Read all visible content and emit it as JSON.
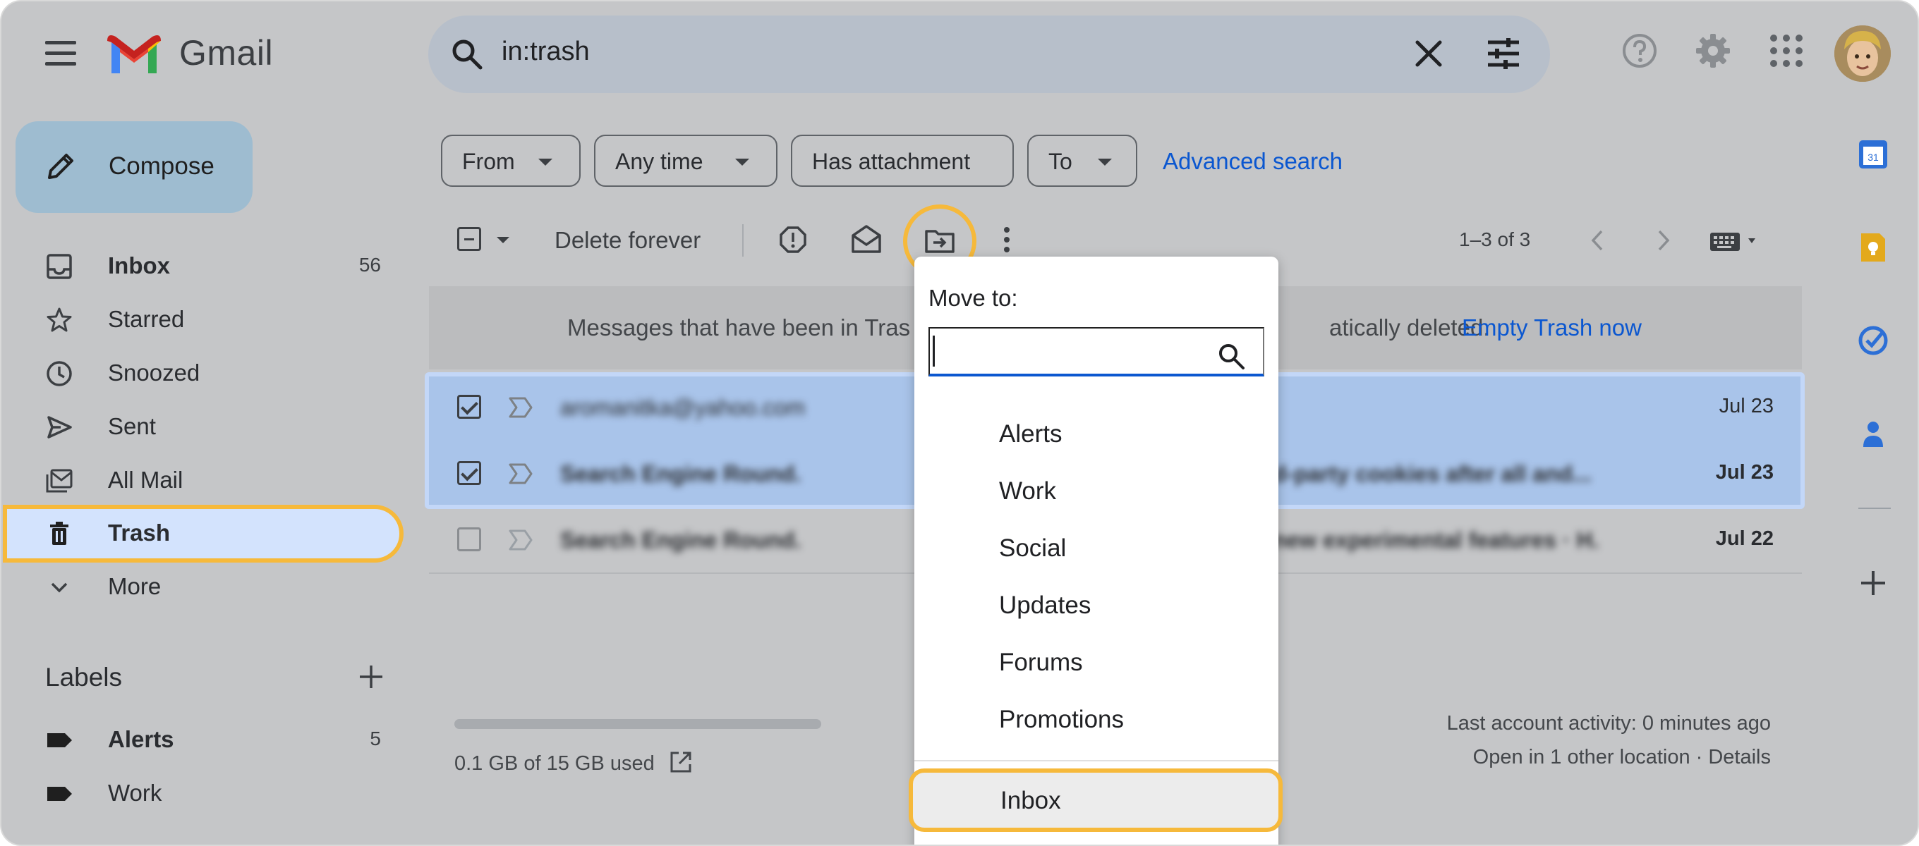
{
  "app": {
    "name": "Gmail"
  },
  "search": {
    "query": "in:trash"
  },
  "compose": {
    "label": "Compose"
  },
  "nav": {
    "inbox": {
      "label": "Inbox",
      "count": "56"
    },
    "starred": {
      "label": "Starred"
    },
    "snoozed": {
      "label": "Snoozed"
    },
    "sent": {
      "label": "Sent"
    },
    "all_mail": {
      "label": "All Mail"
    },
    "trash": {
      "label": "Trash"
    },
    "more": {
      "label": "More"
    }
  },
  "labels": {
    "heading": "Labels",
    "items": [
      {
        "label": "Alerts",
        "count": "5"
      },
      {
        "label": "Work",
        "count": ""
      }
    ]
  },
  "filters": {
    "from": "From",
    "any_time": "Any time",
    "has_attachment": "Has attachment",
    "to": "To",
    "advanced": "Advanced search"
  },
  "toolbar": {
    "delete_forever": "Delete forever",
    "pagination": "1–3 of 3"
  },
  "banner": {
    "message_start": "Messages that have been in Tras",
    "message_end": "atically deleted.",
    "action": "Empty Trash now"
  },
  "emails": [
    {
      "sender": "aromanitka@yahoo.com",
      "snippet": "",
      "date": "Jul 23",
      "selected": true,
      "unread": false
    },
    {
      "sender": "Search Engine Round.",
      "snippet": "d-party cookies after all and...",
      "date": "Jul 23",
      "selected": true,
      "unread": true
    },
    {
      "sender": "Search Engine Round.",
      "snippet": "new experimental features · H.",
      "date": "Jul 22",
      "selected": false,
      "unread": true
    }
  ],
  "footer": {
    "storage": "0.1 GB of 15 GB used",
    "storage_fraction": 0.0067,
    "activity": "Last account activity: 0 minutes ago",
    "location": "Open in 1 other location · Details"
  },
  "move_menu": {
    "title": "Move to:",
    "search_value": "",
    "options": [
      "Alerts",
      "Work",
      "Social",
      "Updates",
      "Forums",
      "Promotions"
    ],
    "highlighted": "Inbox"
  },
  "colors": {
    "accent": "#0b57d0",
    "highlight_ring": "#f6b93b",
    "selected_row": "#a9c4ea",
    "selected_nav": "#d3e3fd"
  }
}
